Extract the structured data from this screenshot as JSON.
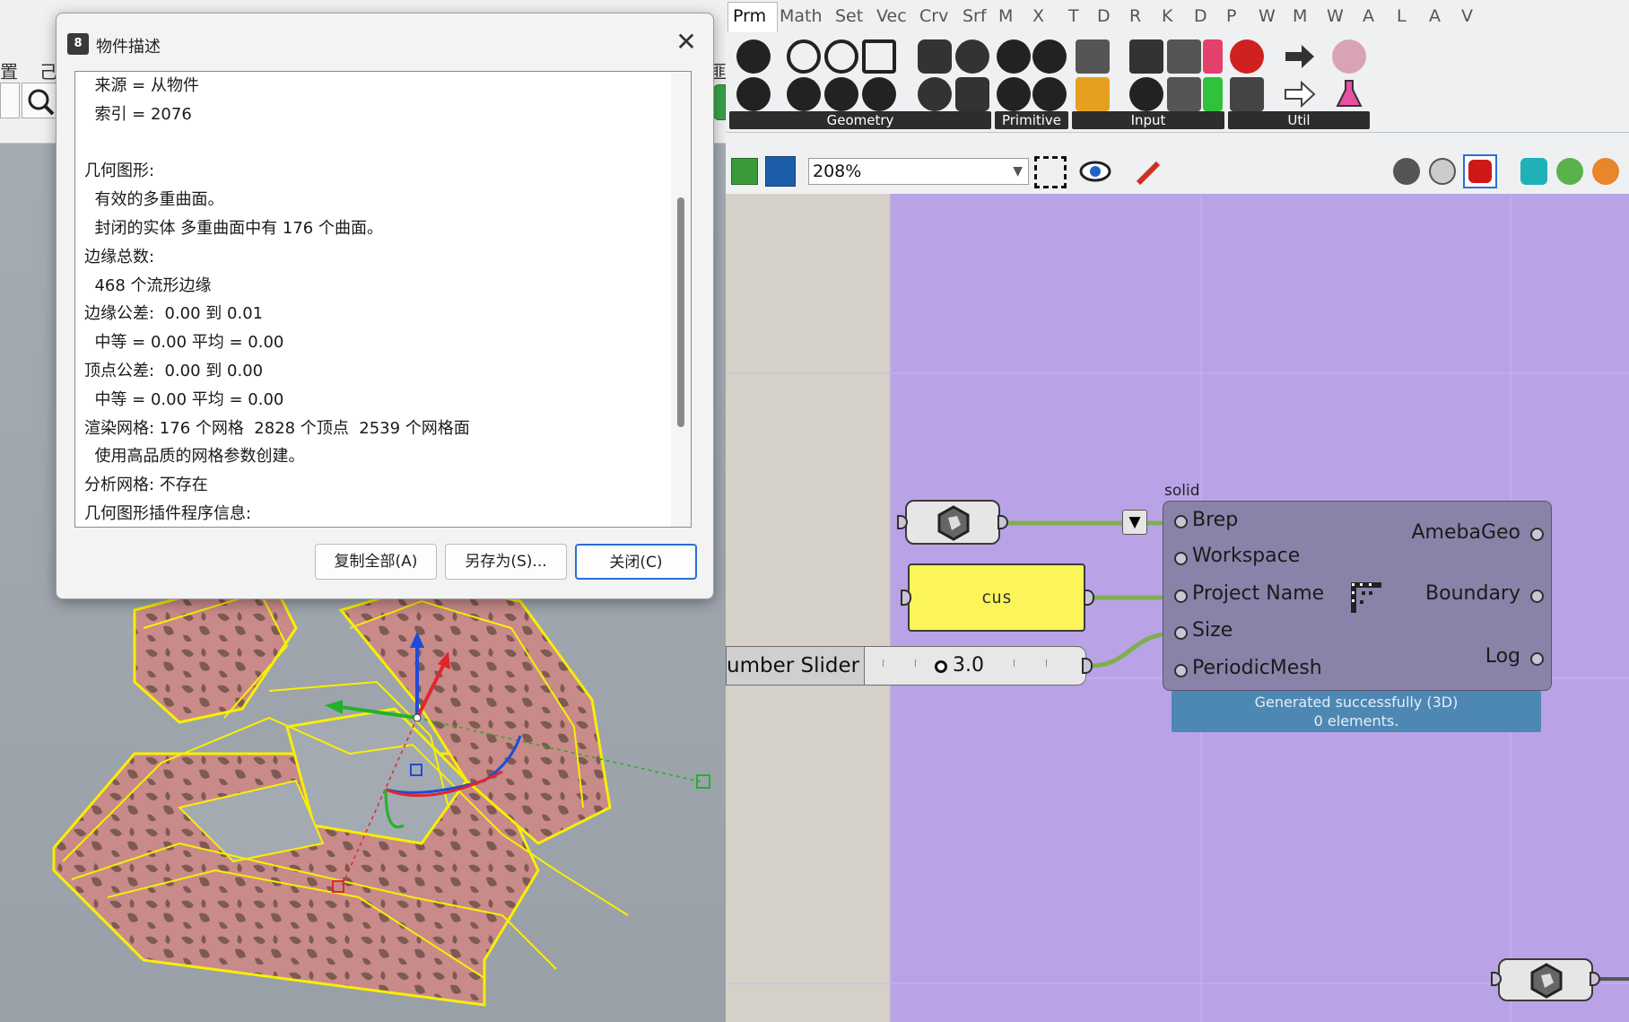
{
  "rhino": {
    "toolbar_text_1": "置",
    "toolbar_text_2": "己",
    "toolbar_text_3": "匪"
  },
  "dialog": {
    "title": "物件描述",
    "app_icon_text": "8",
    "close_glyph": "✕",
    "lines": [
      "  来源 = 从物件",
      "  索引 = 2076",
      "",
      "几何图形:",
      "  有效的多重曲面。",
      "  封闭的实体 多重曲面中有 176 个曲面。",
      "边缘总数:",
      "  468 个流形边缘",
      "边缘公差:  0.00 到 0.01",
      "  中等 = 0.00 平均 = 0.00",
      "顶点公差:  0.00 到 0.00",
      "  中等 = 0.00 平均 = 0.00",
      "渲染网格: 176 个网格  2828 个顶点  2539 个网格面",
      "  使用高品质的网格参数创建。",
      "分析网格: 不存在",
      "几何图形插件程序信息:"
    ],
    "buttons": {
      "copy_all": "复制全部(A)",
      "save_as": "另存为(S)...",
      "close": "关闭(C)"
    }
  },
  "grasshopper": {
    "tabs": [
      "Prm",
      "Math",
      "Set",
      "Vec",
      "Crv",
      "Srf",
      "M",
      "X",
      "T",
      "D",
      "R",
      "K",
      "D",
      "P",
      "W",
      "M",
      "W",
      "A",
      "L",
      "A",
      "V"
    ],
    "active_tab": "Prm",
    "ribbon_groups": [
      "Geometry",
      "Primitive",
      "Input",
      "Util"
    ],
    "zoom": "208%",
    "component": {
      "title": "solid",
      "inputs": [
        "Brep",
        "Workspace",
        "Project Name",
        "Size",
        "PeriodicMesh"
      ],
      "outputs": [
        "AmebaGeo",
        "Boundary",
        "Log"
      ],
      "status_line_1": "Generated successfully (3D)",
      "status_line_2": "0 elements."
    },
    "panel_text": "cus",
    "slider": {
      "label": "umber Slider",
      "value": "3.0"
    }
  },
  "colors": {
    "canvas": "#b9a3e6",
    "wire": "#7fae53",
    "status_bar": "#4d88b4",
    "panel": "#fbf55a",
    "dialog_focus": "#2a6fd6"
  }
}
